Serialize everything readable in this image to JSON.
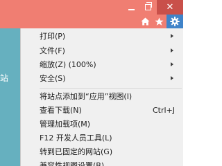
{
  "page": {
    "left_text": "站"
  },
  "window": {
    "min_glyph": "",
    "close_glyph": "✕"
  },
  "menu": {
    "items": [
      {
        "label": "打印(P)"
      },
      {
        "label": "文件(F)"
      },
      {
        "label": "缩放(Z) (100%)"
      },
      {
        "label": "安全(S)"
      },
      {
        "label": "将站点添加到“应用”视图(I)"
      },
      {
        "label": "查看下载(N)",
        "shortcut": "Ctrl+J"
      },
      {
        "label": "管理加载项(M)"
      },
      {
        "label": "F12 开发人员工具(L)"
      },
      {
        "label": "转到已固定的网站(G)"
      },
      {
        "label": "兼容性视图设置(B)"
      }
    ]
  },
  "colors": {
    "titlebar": "#f07e72",
    "close_button": "#c9504a",
    "gear_active": "#3f83c9",
    "page_background": "#66b0bf",
    "menu_background": "#f0f0f0"
  },
  "icons": {
    "home": "home-icon",
    "star": "star-icon",
    "gear": "gear-icon"
  }
}
